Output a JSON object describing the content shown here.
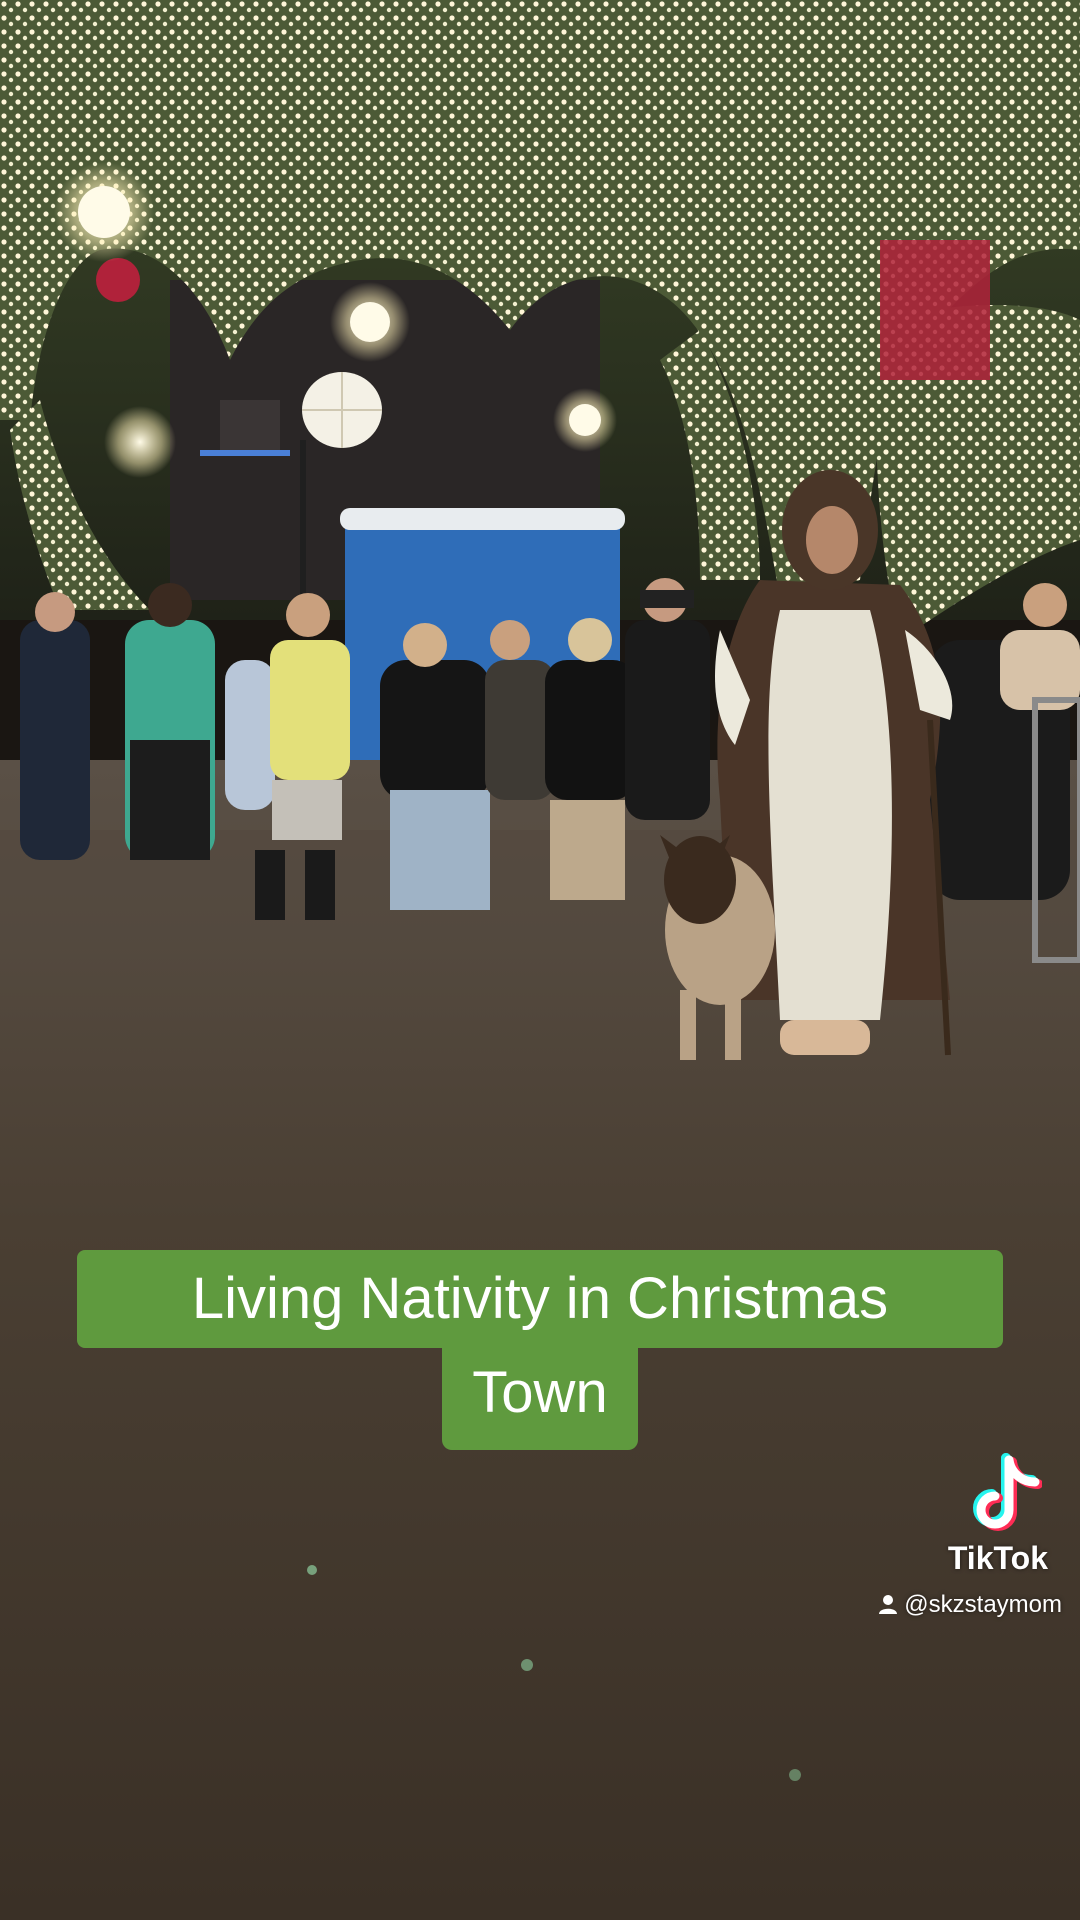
{
  "caption": {
    "line1": "Living Nativity in Christmas",
    "line2": "Town"
  },
  "watermark": {
    "brand": "TikTok",
    "handle": "@skzstaymom",
    "logo_icon": "tiktok-logo-icon",
    "user_icon": "user-icon"
  },
  "colors": {
    "caption_bg": "#5f9a3e",
    "caption_text": "#ffffff",
    "tiktok_cyan": "#25f4ee",
    "tiktok_red": "#fe2c55"
  }
}
